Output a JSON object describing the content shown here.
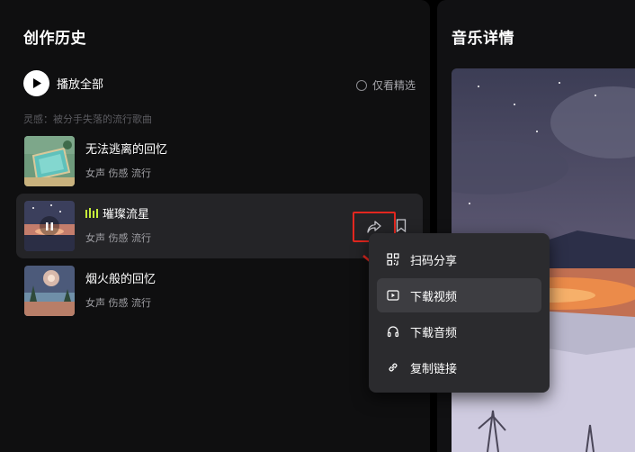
{
  "history": {
    "title": "创作历史",
    "play_all_label": "播放全部",
    "featured_only_label": "仅看精选",
    "inspiration": "灵感：被分手失落的流行歌曲",
    "songs": [
      {
        "title": "无法逃离的回忆",
        "tags": "女声 伤感 流行"
      },
      {
        "title": "璀璨流星",
        "tags": "女声 伤感 流行",
        "playing": true
      },
      {
        "title": "烟火般的回忆",
        "tags": "女声 伤感 流行"
      }
    ]
  },
  "share_menu": {
    "items": [
      {
        "label": "扫码分享",
        "icon": "qr-code-icon"
      },
      {
        "label": "下载视频",
        "icon": "video-icon",
        "highlighted": true
      },
      {
        "label": "下载音频",
        "icon": "headphones-icon"
      },
      {
        "label": "复制链接",
        "icon": "link-icon"
      }
    ]
  },
  "detail": {
    "title": "音乐详情"
  },
  "colors": {
    "accent_green": "#c6ef3a",
    "annotation_red": "#e3271f"
  }
}
